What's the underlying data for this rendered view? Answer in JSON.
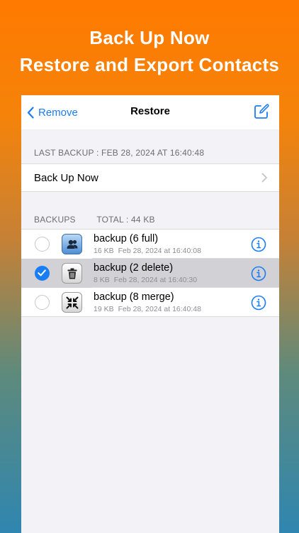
{
  "promo": {
    "line1": "Back Up Now",
    "line2": "Restore and Export Contacts"
  },
  "navbar": {
    "back_label": "Remove",
    "title": "Restore"
  },
  "last_backup": {
    "header": "LAST BACKUP : FEB 28, 2024 AT 16:40:48"
  },
  "backup_now": {
    "label": "Back Up Now"
  },
  "backups": {
    "header": "BACKUPS",
    "total": "TOTAL : 44 KB",
    "items": [
      {
        "title": "backup (6 full)",
        "size": "16 KB",
        "date": "Feb 28, 2024 at 16:40:08",
        "selected": false,
        "icon": "contacts-icon"
      },
      {
        "title": "backup (2 delete)",
        "size": "8 KB",
        "date": "Feb 28, 2024 at 16:40:30",
        "selected": true,
        "icon": "trash-icon"
      },
      {
        "title": "backup (8 merge)",
        "size": "19 KB",
        "date": "Feb 28, 2024 at 16:40:48",
        "selected": false,
        "icon": "merge-icon"
      }
    ]
  },
  "colors": {
    "accent": "#1a7df4",
    "selected_row": "#d1d1d6",
    "promo_top": "#ff7a00",
    "promo_bottom": "#2f86b0"
  }
}
